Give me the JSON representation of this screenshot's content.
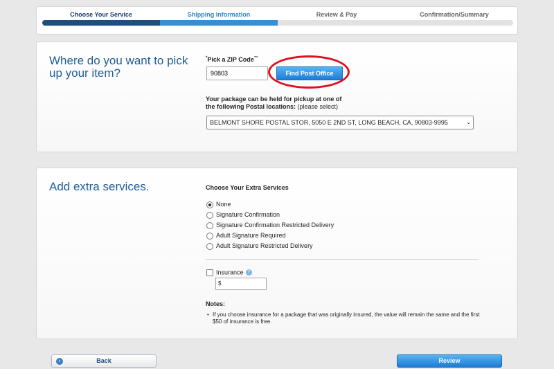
{
  "steps": [
    {
      "label": "Choose Your Service"
    },
    {
      "label": "Shipping Information"
    },
    {
      "label": "Review & Pay"
    },
    {
      "label": "Confirmation/Summary"
    }
  ],
  "pickup": {
    "heading": "Where do you want to pick up your item?",
    "zip_label_required": "*",
    "zip_label": "Pick a ZIP Code",
    "zip_label_tm": "™",
    "zip_value": "90803",
    "find_button": "Find Post Office",
    "held_text": "Your package can be held for pickup at one of the following Postal locations:",
    "held_text_hint": "(please select)",
    "location_selected": "BELMONT SHORE POSTAL STOR, 5050 E 2ND ST, LONG BEACH, CA, 90803-9995",
    "location_chevron": "⌄"
  },
  "extras": {
    "heading": "Add extra services.",
    "choose_title": "Choose Your Extra Services",
    "options": [
      {
        "label": "None",
        "selected": true
      },
      {
        "label": "Signature Confirmation",
        "selected": false
      },
      {
        "label": "Signature Confirmation Restricted Delivery",
        "selected": false
      },
      {
        "label": "Adult Signature Required",
        "selected": false
      },
      {
        "label": "Adult Signature Restricted Delivery",
        "selected": false
      }
    ],
    "insurance_label": "Insurance",
    "insurance_help": "?",
    "insurance_value": "$",
    "notes_title": "Notes:",
    "note": "If you choose insurance for a package that was originally insured, the value will remain the same and the first $50 of insurance is free."
  },
  "footer": {
    "back_label": "Back",
    "back_icon": "‹",
    "review_label": "Review"
  },
  "colors": {
    "accent_blue": "#1f5c99",
    "button_blue": "#1d7cd6",
    "highlight_red": "#e0101f"
  }
}
